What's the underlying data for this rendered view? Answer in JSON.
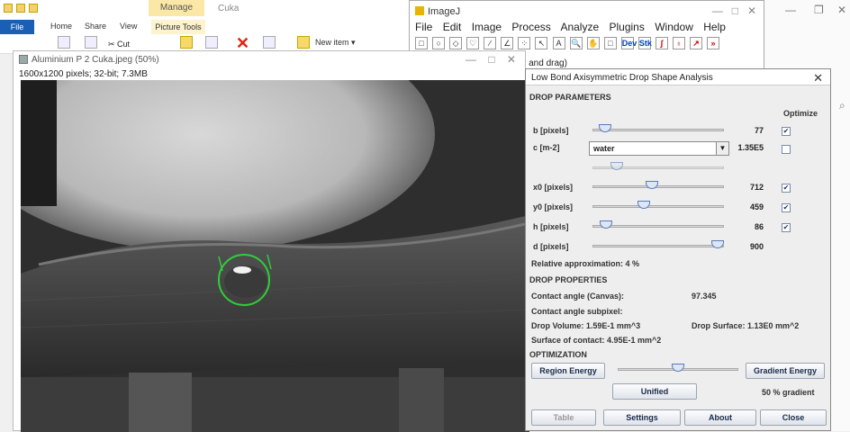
{
  "explorer": {
    "manage_tab": "Manage",
    "title": "Cuka",
    "file_tab": "File",
    "tabs": [
      "Home",
      "Share",
      "View"
    ],
    "picture_tools": "Picture Tools",
    "cut_label": "Cut",
    "new_item_label": "New item ▾"
  },
  "imagej": {
    "title": "ImageJ",
    "menu": [
      "File",
      "Edit",
      "Image",
      "Process",
      "Analyze",
      "Plugins",
      "Window",
      "Help"
    ],
    "tools": [
      "□",
      "○",
      "◇",
      "♡",
      "∕",
      "∠",
      "⁘",
      "↖",
      "A",
      "🔍",
      "✋",
      "□",
      "Dev",
      "Stk",
      "∫",
      "♁",
      "↗",
      "»"
    ],
    "status": "r and drag)"
  },
  "image_window": {
    "title": "Aluminium P 2 Cuka.jpeg (50%)",
    "info": "1600x1200 pixels; 32-bit; 7.3MB"
  },
  "dialog": {
    "title": "Low Bond Axisymmetric Drop Shape Analysis",
    "drop_parameters": "DROP PARAMETERS",
    "optimize_label": "Optimize",
    "params": [
      {
        "label": "b [pixels]",
        "value": "77",
        "checked": true,
        "slider": 0.05
      },
      {
        "label": "x0 [pixels]",
        "value": "712",
        "checked": true,
        "slider": 0.45
      },
      {
        "label": "y0 [pixels]",
        "value": "459",
        "checked": true,
        "slider": 0.38
      },
      {
        "label": "h [pixels]",
        "value": "86",
        "checked": true,
        "slider": 0.06
      },
      {
        "label": "d [pixels]",
        "value": "900",
        "checked": false,
        "slider": 1.0
      }
    ],
    "c_label": "c [m-2]",
    "c_select": "water",
    "c_value": "1.35E5",
    "c_checked": false,
    "c_slider": 0.15,
    "relative_approx": "Relative approximation: 4 %",
    "drop_properties": "DROP PROPERTIES",
    "contact_angle_label": "Contact angle (Canvas):",
    "contact_angle_value": "97.345",
    "contact_angle_subpixel": "Contact angle subpixel:",
    "drop_volume": "Drop Volume: 1.59E-1 mm^3",
    "drop_surface": "Drop Surface: 1.13E0 mm^2",
    "surface_contact": "Surface of contact: 4.95E-1 mm^2",
    "optimization": "OPTIMIZATION",
    "region_energy": "Region Energy",
    "gradient_energy": "Gradient Energy",
    "opt_slider": 0.5,
    "unified": "Unified",
    "gradient_pct": "50 % gradient",
    "table": "Table",
    "settings": "Settings",
    "about": "About",
    "close": "Close"
  }
}
